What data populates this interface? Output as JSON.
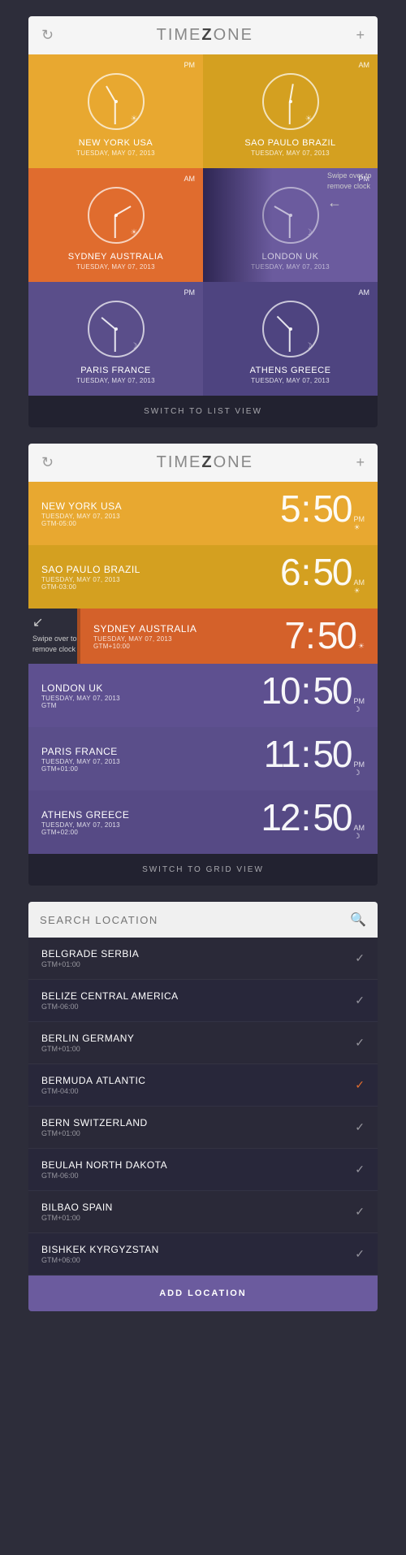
{
  "app": {
    "title_part1": "TIME",
    "title_highlight": "Z",
    "title_part2": "NE",
    "title_full": "TIMEZONE"
  },
  "grid_view": {
    "switch_label": "SWITCH TO LIST VIEW",
    "clocks": [
      {
        "city": "NEW YORK",
        "country": "USA",
        "date": "TUESDAY, MAY 07, 2013",
        "time_label": "PM",
        "color": "yellow",
        "hour_angle": "-30deg",
        "minute_angle": "180deg",
        "icon": "sun"
      },
      {
        "city": "SAO PAULO",
        "country": "BRAZIL",
        "date": "TUESDAY, MAY 07, 2013",
        "time_label": "AM",
        "color": "yellow2",
        "hour_angle": "10deg",
        "minute_angle": "180deg",
        "icon": "sun"
      },
      {
        "city": "SYDNEY",
        "country": "AUSTRALIA",
        "date": "TUESDAY, MAY 07, 2013",
        "time_label": "AM",
        "color": "orange",
        "hour_angle": "60deg",
        "minute_angle": "180deg",
        "icon": "sun"
      },
      {
        "city": "LONDON",
        "country": "UK",
        "date": "TUESDAY, MAY 07, 2013",
        "time_label": "PM",
        "color": "purple-light",
        "hour_angle": "-60deg",
        "minute_angle": "180deg",
        "icon": "moon"
      },
      {
        "city": "PARIS",
        "country": "FRANCE",
        "date": "TUESDAY, MAY 07, 2013",
        "time_label": "PM",
        "color": "purple",
        "hour_angle": "-50deg",
        "minute_angle": "180deg",
        "icon": "moon"
      },
      {
        "city": "ATHENS",
        "country": "GREECE",
        "date": "TUESDAY, MAY 07, 2013",
        "time_label": "AM",
        "color": "purple2",
        "hour_angle": "-45deg",
        "minute_angle": "180deg",
        "icon": "moon"
      }
    ]
  },
  "list_view": {
    "switch_label": "SWITCH TO GRID VIEW",
    "items": [
      {
        "city": "NEW YORK",
        "country": "USA",
        "date": "TUESDAY, MAY 07, 2013",
        "gtm": "GTM-05:00",
        "hours": "5",
        "minutes": "50",
        "ampm": "PM",
        "icon": "sun",
        "color": "yellow"
      },
      {
        "city": "SAO PAULO",
        "country": "BRAZIL",
        "date": "TUESDAY, MAY 07, 2013",
        "gtm": "GTM-03:00",
        "hours": "6",
        "minutes": "50",
        "ampm": "AM",
        "icon": "sun",
        "color": "yellow2"
      },
      {
        "city": "SYDNEY",
        "country": "AUSTRALIA",
        "date": "TUESDAY, MAY 07, 2013",
        "gtm": "GTM+10:00",
        "hours": "7",
        "minutes": "50",
        "ampm": "",
        "icon": "sun",
        "color": "orange",
        "folded": true
      },
      {
        "city": "LONDON",
        "country": "UK",
        "date": "TUESDAY, MAY 07, 2013",
        "gtm": "GTM",
        "hours": "10",
        "minutes": "50",
        "ampm": "PM",
        "icon": "moon",
        "color": "purple1"
      },
      {
        "city": "PARIS",
        "country": "FRANCE",
        "date": "TUESDAY, MAY 07, 2013",
        "gtm": "GTM+01:00",
        "hours": "11",
        "minutes": "50",
        "ampm": "PM",
        "icon": "moon",
        "color": "purple2"
      },
      {
        "city": "ATHENS",
        "country": "GREECE",
        "date": "TUESDAY, MAY 07, 2013",
        "gtm": "GTM+02:00",
        "hours": "12",
        "minutes": "50",
        "ampm": "AM",
        "icon": "moon",
        "color": "purple3"
      }
    ]
  },
  "search_view": {
    "placeholder": "SEARCH LOCATION",
    "locations": [
      {
        "city": "BELGRADE",
        "country": "SERBIA",
        "gtm": "GTM+01:00",
        "checked": true,
        "orange": false
      },
      {
        "city": "BELIZE",
        "country": "CENTRAL AMERICA",
        "gtm": "GTM-06:00",
        "checked": true,
        "orange": false
      },
      {
        "city": "BERLIN",
        "country": "GERMANY",
        "gtm": "GTM+01:00",
        "checked": true,
        "orange": false
      },
      {
        "city": "BERMUDA",
        "country": "ATLANTIC",
        "gtm": "GTM-04:00",
        "checked": true,
        "orange": true
      },
      {
        "city": "BERN",
        "country": "SWITZERLAND",
        "gtm": "GTM+01:00",
        "checked": true,
        "orange": false
      },
      {
        "city": "BEULAH",
        "country": "NORTH DAKOTA",
        "gtm": "GTM-06:00",
        "checked": true,
        "orange": false
      },
      {
        "city": "BILBAO",
        "country": "SPAIN",
        "gtm": "GTM+01:00",
        "checked": true,
        "orange": false
      },
      {
        "city": "BISHKEK",
        "country": "KYRGYZSTAN",
        "gtm": "GTM+06:00",
        "checked": true,
        "orange": false
      }
    ],
    "add_button": "ADD LOCATION"
  },
  "swipe_hints": {
    "grid_hint": "Swipe over to remove clock",
    "list_hint": "Swipe over to remove clock"
  }
}
